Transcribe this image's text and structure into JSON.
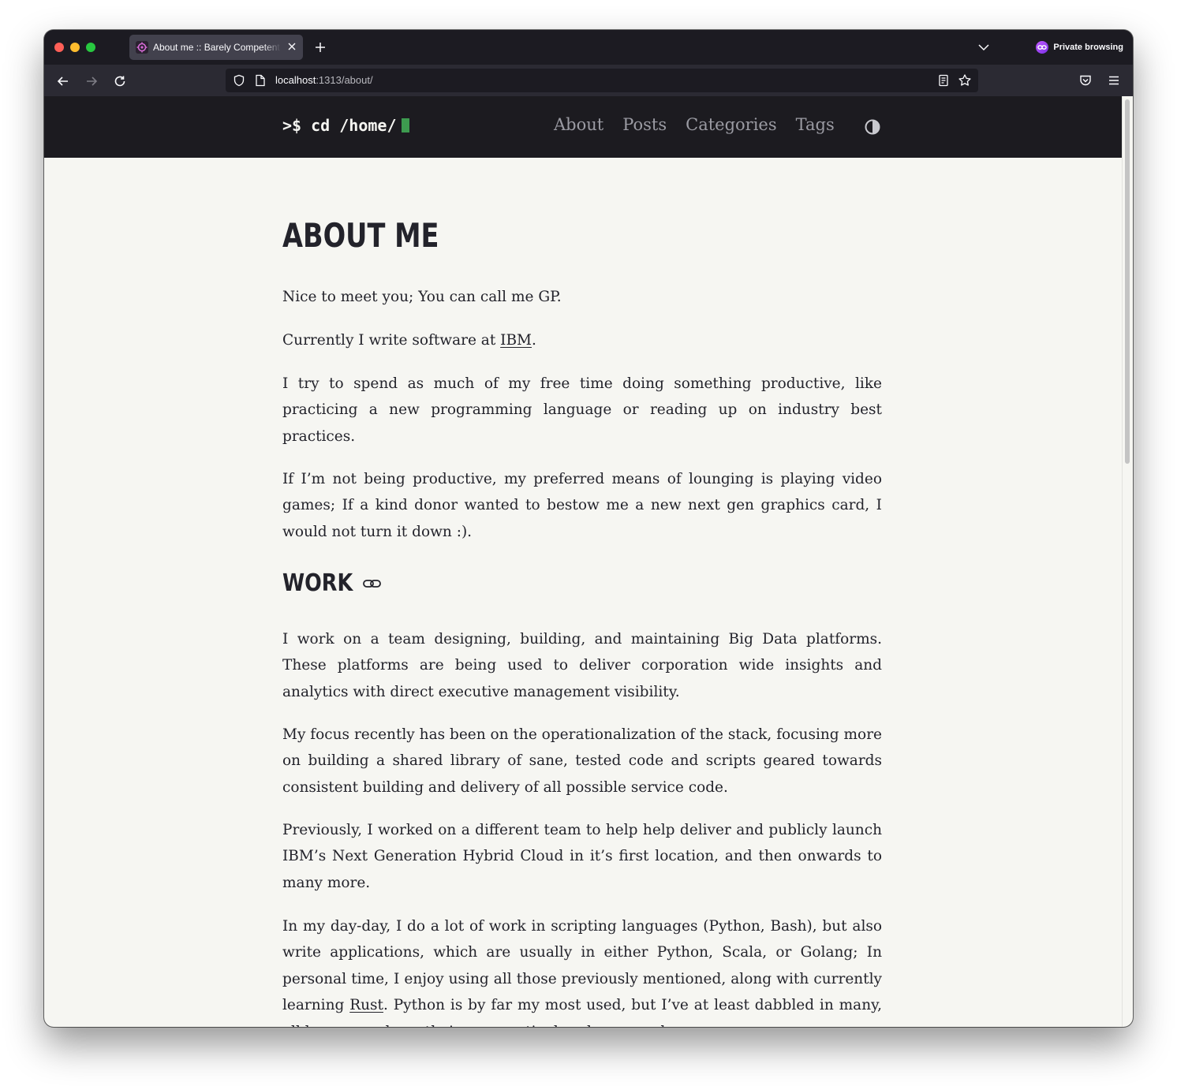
{
  "browser": {
    "tab_title": "About me :: Barely Competent Dev",
    "url_host": "localhost",
    "url_path": ":1313/about/",
    "private_label": "Private browsing"
  },
  "site": {
    "logo_text": ">$ cd /home/",
    "menu": [
      "About",
      "Posts",
      "Categories",
      "Tags"
    ],
    "cursor_color": "#3d9b4f"
  },
  "article": {
    "title": "ABOUT ME",
    "p1": "Nice to meet you; You can call me GP.",
    "p2_before": "Currently I write software at ",
    "p2_link": "IBM",
    "p2_after": ".",
    "p3": "I try to spend as much of my free time doing something productive, like practicing a new programming language or reading up on industry best practices.",
    "p4": "If I’m not being productive, my preferred means of lounging is playing video games; If a kind donor wanted to bestow me a new next gen graphics card, I would not turn it down :).",
    "h2": "WORK",
    "p5": "I work on a team designing, building, and maintaining Big Data platforms. These platforms are being used to deliver corporation wide insights and analytics with direct executive management visibility.",
    "p6": "My focus recently has been on the operationalization of the stack, focusing more on building a shared library of sane, tested code and scripts geared towards consistent building and delivery of all possible service code.",
    "p7": "Previously, I worked on a different team to help help deliver and publicly launch IBM’s Next Generation Hybrid Cloud in it’s first location, and then onwards to many more.",
    "p8_before": "In my day-day, I do a lot of work in scripting languages (Python, Bash), but also write applications, which are usually in either Python, Scala, or Golang; In personal time, I enjoy using all those previously mentioned, along with currently learning ",
    "p8_link": "Rust",
    "p8_after": ". Python is by far my most used, but I’ve at least dabbled in many, all languages have their own particular charms and"
  }
}
